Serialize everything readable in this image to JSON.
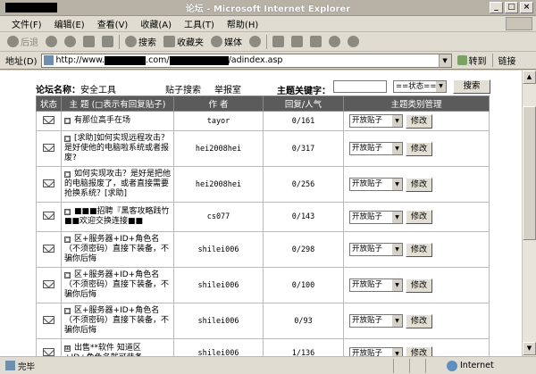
{
  "window": {
    "title": "论坛 - Microsoft Internet Explorer",
    "controls": [
      "_",
      "□",
      "×"
    ]
  },
  "menubar": [
    "文件(F)",
    "编辑(E)",
    "查看(V)",
    "收藏(A)",
    "工具(T)",
    "帮助(H)"
  ],
  "toolbar": {
    "back": "后退",
    "search": "搜索",
    "favorites": "收藏夹",
    "media": "媒体"
  },
  "address": {
    "label": "地址(D)",
    "url_prefix": "http://www.",
    "url_mid": ".com/",
    "url_suffix": "/adindex.asp",
    "go": "转到",
    "links": "链接"
  },
  "forum": {
    "name_label": "论坛名称：",
    "name_value": "安全工具",
    "link_posts": "贴子搜索",
    "link_report": "举报室",
    "keyword_label": "主题关键字：",
    "status_select": "==状态==",
    "search_button": "搜索"
  },
  "table": {
    "headers": [
      "状态",
      "主 题 (□表示有回复贴子)",
      "作 者",
      "回复/人气",
      "主题类别管理"
    ],
    "select_value": "开放贴子",
    "edit_button": "修改",
    "rows": [
      {
        "expand": "□",
        "topic": "有那位高手在场",
        "author": "tayor",
        "stats": "0/161"
      },
      {
        "expand": "□",
        "topic": "[求助]如何实现远程攻击？是好使他的电脑啦系统或者报废?",
        "author": "hei2008hei",
        "stats": "0/317"
      },
      {
        "expand": "□",
        "topic": "如何实现攻击？是好是把他的电脑报废了，或者直接需要抢换系统？[求助]",
        "author": "hei2008hei",
        "stats": "0/256"
      },
      {
        "expand": "□",
        "topic": "■■■招聘『黑客攻略践竹■■欢迎交换连接■■",
        "author": "cs077",
        "stats": "0/143"
      },
      {
        "expand": "□",
        "topic": "区+服务器+ID+角色名（不须密码）直接下装备，不骗你后悔",
        "author": "shilei006",
        "stats": "0/298"
      },
      {
        "expand": "□",
        "topic": "区+服务器+ID+角色名（不须密码）直接下装备，不骗你后悔",
        "author": "shilei006",
        "stats": "0/100"
      },
      {
        "expand": "□",
        "topic": "区+服务器+ID+角色名（不须密码）直接下装备，不骗你后悔",
        "author": "shilei006",
        "stats": "0/93"
      },
      {
        "expand": "⊞",
        "topic": "出售**软件 知道区+ID+角色名就可装备",
        "author": "shilei006",
        "stats": "1/136"
      }
    ]
  },
  "statusbar": {
    "left": "完毕",
    "zone": "Internet"
  }
}
